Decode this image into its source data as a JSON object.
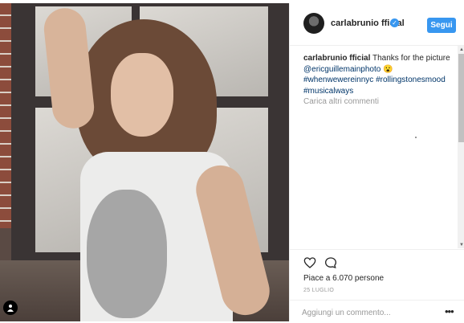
{
  "post": {
    "username": "carlabrunio fficial",
    "follow_label": "Segui",
    "caption": {
      "author": "carlabrunio fficial",
      "text": "Thanks for the picture",
      "mention": "@ericguillemainphoto",
      "emoji": "😮",
      "hashtags": [
        "#whenwewereinnyc",
        "#rollingstonesmood",
        "#musicalways"
      ]
    },
    "load_more_label": "Carica altri commenti",
    "likes_text": "Piace a 6.070 persone",
    "date": "25 LUGLIO",
    "comment_placeholder": "Aggiungi un commento...",
    "more_icon": "•••"
  },
  "icons": {
    "verified": "verified-badge",
    "like": "heart-outline",
    "comment": "speech-bubble",
    "tag": "user-tag"
  },
  "colors": {
    "accent": "#3897f0",
    "link": "#003569",
    "muted": "#999999"
  }
}
